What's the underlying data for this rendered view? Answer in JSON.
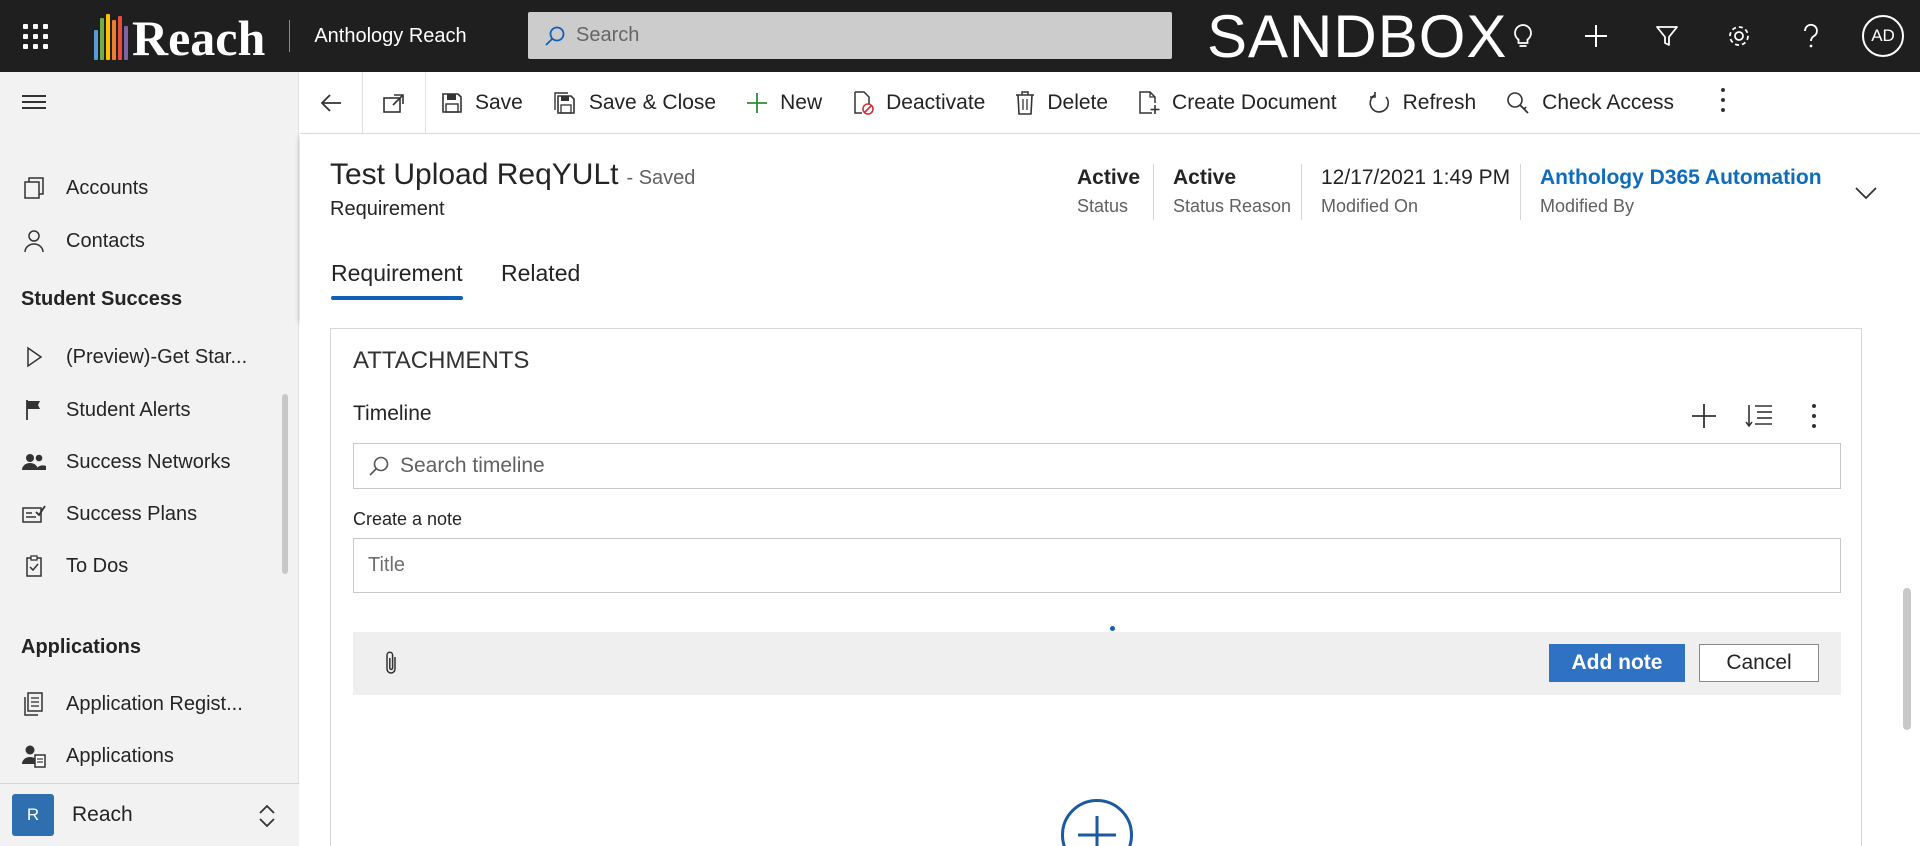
{
  "topbar": {
    "logo_text": "Reach",
    "logo_bar_colors": [
      "#5b9bd5",
      "#70ad47",
      "#ffc000",
      "#ed7d31",
      "#e84c3d",
      "#a5a5a5"
    ],
    "app_name": "Anthology Reach",
    "search_placeholder": "Search",
    "environment_label": "SANDBOX",
    "user_initials": "AD"
  },
  "sidebar": {
    "items_top": [
      {
        "label": "Accounts",
        "icon": "accounts-icon"
      },
      {
        "label": "Contacts",
        "icon": "contacts-icon"
      }
    ],
    "student_success_heading": "Student Success",
    "student_success_items": [
      {
        "label": "(Preview)-Get Star...",
        "icon": "play-icon"
      },
      {
        "label": "Student Alerts",
        "icon": "flag-icon"
      },
      {
        "label": "Success Networks",
        "icon": "people-icon"
      },
      {
        "label": "Success Plans",
        "icon": "plan-icon"
      },
      {
        "label": "To Dos",
        "icon": "clipboard-check-icon"
      }
    ],
    "applications_heading": "Applications",
    "applications_items": [
      {
        "label": "Application Regist...",
        "icon": "document-icon"
      },
      {
        "label": "Applications",
        "icon": "person-document-icon"
      }
    ],
    "area": {
      "badge": "R",
      "name": "Reach"
    }
  },
  "commandbar": {
    "save": "Save",
    "save_close": "Save & Close",
    "new": "New",
    "deactivate": "Deactivate",
    "delete": "Delete",
    "create_document": "Create Document",
    "refresh": "Refresh",
    "check_access": "Check Access"
  },
  "record": {
    "title": "Test Upload ReqYULt",
    "saved_state": "- Saved",
    "entity": "Requirement",
    "fields": {
      "status_value": "Active",
      "status_label": "Status",
      "status_reason_value": "Active",
      "status_reason_label": "Status Reason",
      "modified_on_value": "12/17/2021 1:49 PM",
      "modified_on_label": "Modified On",
      "modified_by_value": "Anthology D365 Automation",
      "modified_by_label": "Modified By"
    },
    "tabs": [
      "Requirement",
      "Related"
    ],
    "active_tab": "Requirement"
  },
  "attachments": {
    "section_title": "ATTACHMENTS",
    "timeline_title": "Timeline",
    "search_placeholder": "Search timeline",
    "create_note_label": "Create a note",
    "note_title_placeholder": "Title",
    "add_note_button": "Add note",
    "cancel_button": "Cancel"
  }
}
